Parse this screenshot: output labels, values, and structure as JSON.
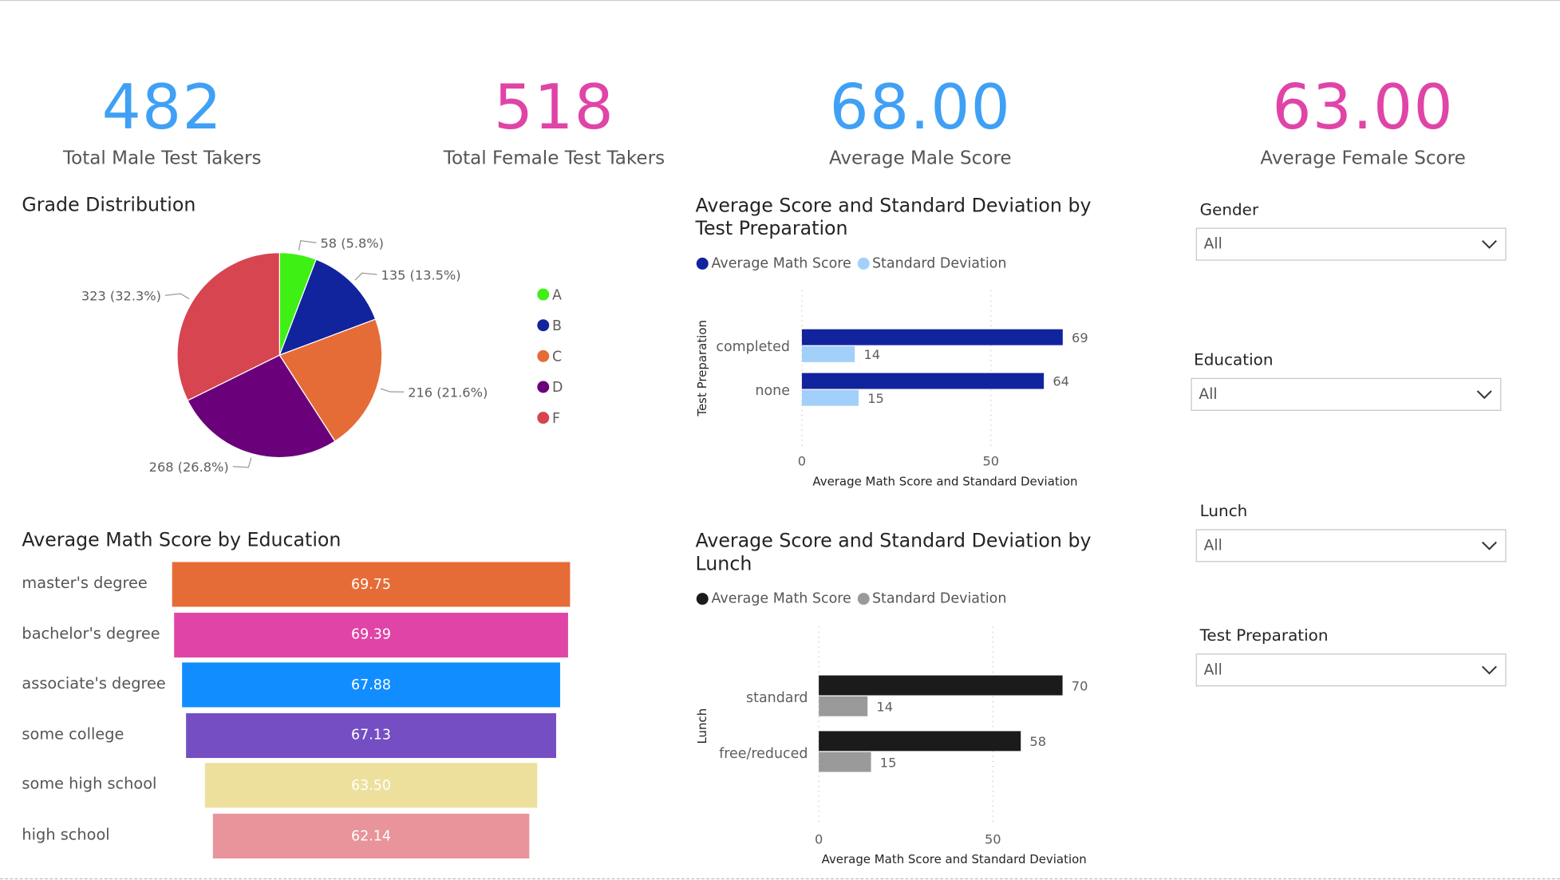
{
  "kpis": [
    {
      "value": "482",
      "label": "Total Male Test Takers",
      "color": "#3FA0F5"
    },
    {
      "value": "518",
      "label": "Total Female Test Takers",
      "color": "#E044A7"
    },
    {
      "value": "68.00",
      "label": "Average Male Score",
      "color": "#3FA0F5"
    },
    {
      "value": "63.00",
      "label": "Average Female Score",
      "color": "#E044A7"
    }
  ],
  "grade": {
    "title": "Grade Distribution",
    "legend": [
      {
        "label": "A",
        "color": "#3FF015"
      },
      {
        "label": "B",
        "color": "#12239E"
      },
      {
        "label": "C",
        "color": "#E66C37"
      },
      {
        "label": "D",
        "color": "#6B007B"
      },
      {
        "label": "F",
        "color": "#D64550"
      }
    ],
    "slice_labels": [
      "58 (5.8%)",
      "135 (13.5%)",
      "216 (21.6%)",
      "268 (26.8%)",
      "323 (32.3%)"
    ]
  },
  "education": {
    "title": "Average Math Score by Education",
    "rows": [
      {
        "label": "master's degree",
        "value": "69.75",
        "color": "#E66C37"
      },
      {
        "label": "bachelor's degree",
        "value": "69.39",
        "color": "#E044A7"
      },
      {
        "label": "associate's degree",
        "value": "67.88",
        "color": "#118DFF"
      },
      {
        "label": "some college",
        "value": "67.13",
        "color": "#744EC2"
      },
      {
        "label": "some high school",
        "value": "63.50",
        "color": "#EDE09C"
      },
      {
        "label": "high school",
        "value": "62.14",
        "color": "#E8949A"
      }
    ]
  },
  "prep_chart": {
    "title": "Average Score and Standard Deviation by Test Preparation",
    "legend": [
      {
        "label": "Average Math Score",
        "color": "#12239E"
      },
      {
        "label": "Standard Deviation",
        "color": "#A3CFFB"
      }
    ],
    "ylabel": "Test Preparation",
    "xlabel": "Average Math Score and Standard Deviation"
  },
  "lunch_chart": {
    "title": "Average Score and Standard Deviation by Lunch",
    "legend": [
      {
        "label": "Average Math Score",
        "color": "#1B1B1B"
      },
      {
        "label": "Standard Deviation",
        "color": "#9A9A9A"
      }
    ],
    "ylabel": "Lunch",
    "xlabel": "Average Math Score and Standard Deviation"
  },
  "slicers": [
    {
      "title": "Gender",
      "value": "All"
    },
    {
      "title": "Education",
      "value": "All"
    },
    {
      "title": "Lunch",
      "value": "All"
    },
    {
      "title": "Test Preparation",
      "value": "All"
    }
  ],
  "chart_data": [
    {
      "type": "pie",
      "title": "Grade Distribution",
      "categories": [
        "A",
        "B",
        "C",
        "D",
        "F"
      ],
      "values": [
        58,
        135,
        216,
        268,
        323
      ],
      "percents": [
        5.8,
        13.5,
        21.6,
        26.8,
        32.3
      ],
      "legend": "right"
    },
    {
      "type": "bar",
      "title": "Average Math Score by Education",
      "categories": [
        "master's degree",
        "bachelor's degree",
        "associate's degree",
        "some college",
        "some high school",
        "high school"
      ],
      "values": [
        69.75,
        69.39,
        67.88,
        67.13,
        63.5,
        62.14
      ]
    },
    {
      "type": "bar",
      "title": "Average Score and Standard Deviation by Test Preparation",
      "categories": [
        "completed",
        "none"
      ],
      "series": [
        {
          "name": "Average Math Score",
          "values": [
            69,
            64
          ]
        },
        {
          "name": "Standard Deviation",
          "values": [
            14,
            15
          ]
        }
      ],
      "xlabel": "Average Math Score and Standard Deviation",
      "ylabel": "Test Preparation",
      "ticks": [
        0,
        50
      ],
      "xlim": [
        0,
        70
      ],
      "grid": true,
      "legend": "top-left"
    },
    {
      "type": "bar",
      "title": "Average Score and Standard Deviation by Lunch",
      "categories": [
        "standard",
        "free/reduced"
      ],
      "series": [
        {
          "name": "Average Math Score",
          "values": [
            70,
            58
          ]
        },
        {
          "name": "Standard Deviation",
          "values": [
            14,
            15
          ]
        }
      ],
      "xlabel": "Average Math Score and Standard Deviation",
      "ylabel": "Lunch",
      "ticks": [
        0,
        50
      ],
      "xlim": [
        0,
        70
      ],
      "grid": true,
      "legend": "top-left"
    }
  ]
}
